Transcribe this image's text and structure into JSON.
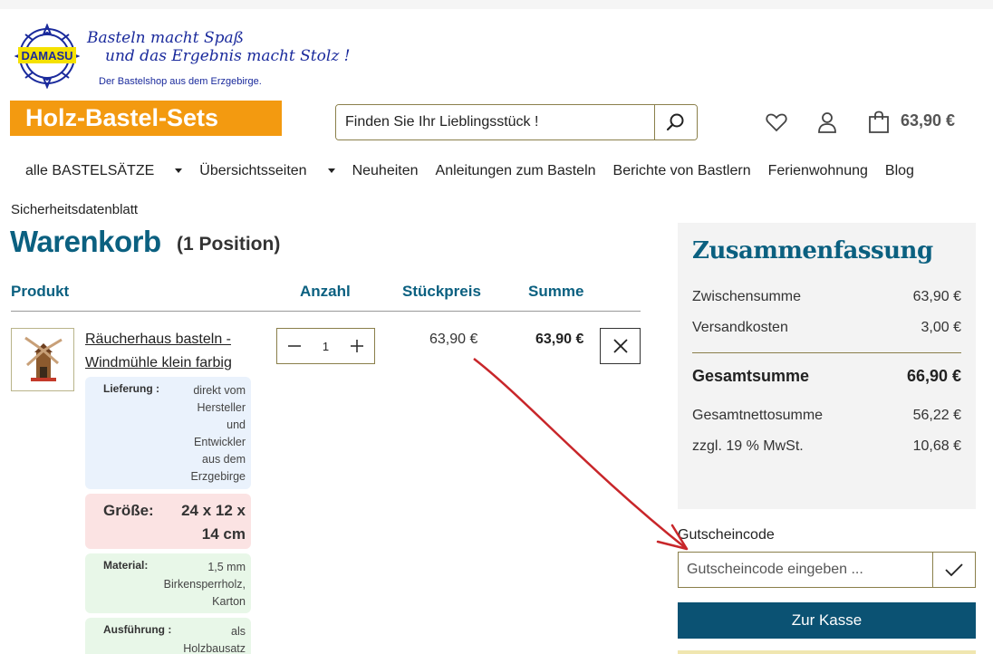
{
  "logo": {
    "emblem_text": "DAMASU",
    "slogan_line1": "Basteln macht Spaß",
    "slogan_line2": "und das Ergebnis macht Stolz !",
    "tagline": "Der Bastelshop aus dem Erzgebirge.",
    "banner": "Holz-Bastel-Sets"
  },
  "search": {
    "placeholder": "Finden Sie Ihr Lieblingsstück !",
    "icon": "search-icon"
  },
  "header_icons": [
    "heart-icon",
    "user-icon",
    "shopping-bag-icon"
  ],
  "cart_total": "63,90 €",
  "nav": {
    "items": [
      {
        "label": "alle BASTELSÄTZE",
        "dropdown": true
      },
      {
        "label": "Übersichtsseiten",
        "dropdown": true
      },
      {
        "label": "Neuheiten",
        "dropdown": false
      },
      {
        "label": "Anleitungen zum Basteln",
        "dropdown": false
      },
      {
        "label": "Berichte von Bastlern",
        "dropdown": false
      },
      {
        "label": "Ferienwohnung",
        "dropdown": false
      },
      {
        "label": "Blog",
        "dropdown": false
      }
    ]
  },
  "breadcrumb": "Sicherheitsdatenblatt",
  "page": {
    "title": "Warenkorb",
    "count": "(1 Position)"
  },
  "table": {
    "headers": {
      "product": "Produkt",
      "quantity": "Anzahl",
      "unit_price": "Stückpreis",
      "sum": "Summe"
    }
  },
  "item": {
    "name": "Räucherhaus basteln - Windmühle klein farbig",
    "quantity": "1",
    "unit_price": "63,90 €",
    "sum": "63,90 €",
    "attributes": {
      "delivery_label": "Lieferung :",
      "delivery_value": "direkt vom Hersteller und Entwickler aus dem Erzgebirge",
      "size_label": "Größe:",
      "size_value": "24 x 12 x 14 cm",
      "material_label": "Material:",
      "material_value": "1,5 mm Birkensperrholz, Karton",
      "execution_label": "Ausführung :",
      "execution_value": "als Holzbausatz"
    }
  },
  "summary": {
    "title": "Zusammenfassung",
    "subtotal_label": "Zwischensumme",
    "subtotal": "63,90 €",
    "shipping_label": "Versandkosten",
    "shipping": "3,00 €",
    "total_label": "Gesamtsumme",
    "total": "66,90 €",
    "net_label": "Gesamtnettosumme",
    "net": "56,22 €",
    "vat_label": "zzgl. 19 % MwSt.",
    "vat": "10,68 €"
  },
  "coupon": {
    "label": "Gutscheincode",
    "placeholder": "Gutscheincode eingeben ...",
    "icon": "check-icon"
  },
  "checkout_label": "Zur Kasse",
  "colors": {
    "accent": "#0b6080",
    "banner": "#f39a10",
    "checkout": "#0b5273",
    "annotation_arrow": "#c8262a"
  }
}
